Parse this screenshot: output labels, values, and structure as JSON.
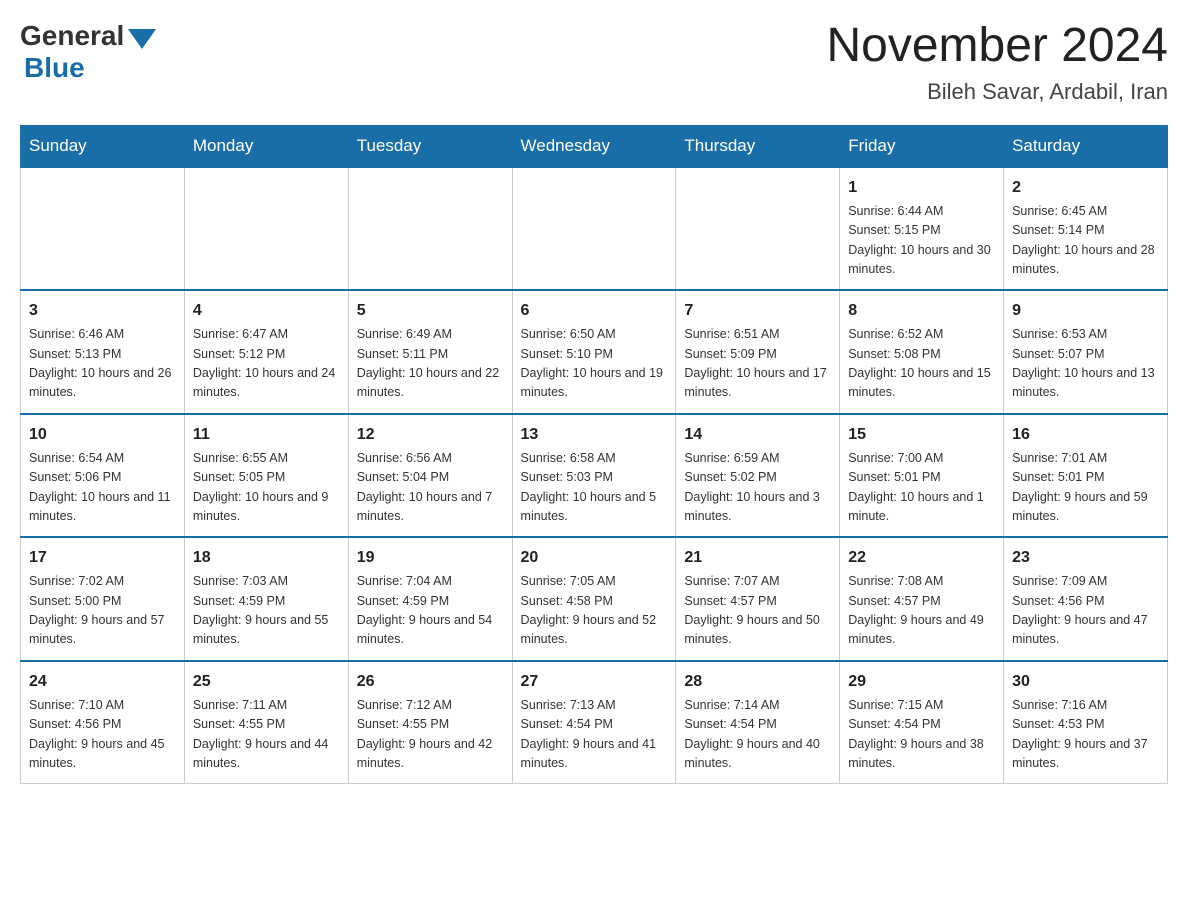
{
  "header": {
    "logo_general": "General",
    "logo_blue": "Blue",
    "month_title": "November 2024",
    "location": "Bileh Savar, Ardabil, Iran"
  },
  "weekdays": [
    "Sunday",
    "Monday",
    "Tuesday",
    "Wednesday",
    "Thursday",
    "Friday",
    "Saturday"
  ],
  "rows": [
    [
      {
        "day": "",
        "sunrise": "",
        "sunset": "",
        "daylight": ""
      },
      {
        "day": "",
        "sunrise": "",
        "sunset": "",
        "daylight": ""
      },
      {
        "day": "",
        "sunrise": "",
        "sunset": "",
        "daylight": ""
      },
      {
        "day": "",
        "sunrise": "",
        "sunset": "",
        "daylight": ""
      },
      {
        "day": "",
        "sunrise": "",
        "sunset": "",
        "daylight": ""
      },
      {
        "day": "1",
        "sunrise": "Sunrise: 6:44 AM",
        "sunset": "Sunset: 5:15 PM",
        "daylight": "Daylight: 10 hours and 30 minutes."
      },
      {
        "day": "2",
        "sunrise": "Sunrise: 6:45 AM",
        "sunset": "Sunset: 5:14 PM",
        "daylight": "Daylight: 10 hours and 28 minutes."
      }
    ],
    [
      {
        "day": "3",
        "sunrise": "Sunrise: 6:46 AM",
        "sunset": "Sunset: 5:13 PM",
        "daylight": "Daylight: 10 hours and 26 minutes."
      },
      {
        "day": "4",
        "sunrise": "Sunrise: 6:47 AM",
        "sunset": "Sunset: 5:12 PM",
        "daylight": "Daylight: 10 hours and 24 minutes."
      },
      {
        "day": "5",
        "sunrise": "Sunrise: 6:49 AM",
        "sunset": "Sunset: 5:11 PM",
        "daylight": "Daylight: 10 hours and 22 minutes."
      },
      {
        "day": "6",
        "sunrise": "Sunrise: 6:50 AM",
        "sunset": "Sunset: 5:10 PM",
        "daylight": "Daylight: 10 hours and 19 minutes."
      },
      {
        "day": "7",
        "sunrise": "Sunrise: 6:51 AM",
        "sunset": "Sunset: 5:09 PM",
        "daylight": "Daylight: 10 hours and 17 minutes."
      },
      {
        "day": "8",
        "sunrise": "Sunrise: 6:52 AM",
        "sunset": "Sunset: 5:08 PM",
        "daylight": "Daylight: 10 hours and 15 minutes."
      },
      {
        "day": "9",
        "sunrise": "Sunrise: 6:53 AM",
        "sunset": "Sunset: 5:07 PM",
        "daylight": "Daylight: 10 hours and 13 minutes."
      }
    ],
    [
      {
        "day": "10",
        "sunrise": "Sunrise: 6:54 AM",
        "sunset": "Sunset: 5:06 PM",
        "daylight": "Daylight: 10 hours and 11 minutes."
      },
      {
        "day": "11",
        "sunrise": "Sunrise: 6:55 AM",
        "sunset": "Sunset: 5:05 PM",
        "daylight": "Daylight: 10 hours and 9 minutes."
      },
      {
        "day": "12",
        "sunrise": "Sunrise: 6:56 AM",
        "sunset": "Sunset: 5:04 PM",
        "daylight": "Daylight: 10 hours and 7 minutes."
      },
      {
        "day": "13",
        "sunrise": "Sunrise: 6:58 AM",
        "sunset": "Sunset: 5:03 PM",
        "daylight": "Daylight: 10 hours and 5 minutes."
      },
      {
        "day": "14",
        "sunrise": "Sunrise: 6:59 AM",
        "sunset": "Sunset: 5:02 PM",
        "daylight": "Daylight: 10 hours and 3 minutes."
      },
      {
        "day": "15",
        "sunrise": "Sunrise: 7:00 AM",
        "sunset": "Sunset: 5:01 PM",
        "daylight": "Daylight: 10 hours and 1 minute."
      },
      {
        "day": "16",
        "sunrise": "Sunrise: 7:01 AM",
        "sunset": "Sunset: 5:01 PM",
        "daylight": "Daylight: 9 hours and 59 minutes."
      }
    ],
    [
      {
        "day": "17",
        "sunrise": "Sunrise: 7:02 AM",
        "sunset": "Sunset: 5:00 PM",
        "daylight": "Daylight: 9 hours and 57 minutes."
      },
      {
        "day": "18",
        "sunrise": "Sunrise: 7:03 AM",
        "sunset": "Sunset: 4:59 PM",
        "daylight": "Daylight: 9 hours and 55 minutes."
      },
      {
        "day": "19",
        "sunrise": "Sunrise: 7:04 AM",
        "sunset": "Sunset: 4:59 PM",
        "daylight": "Daylight: 9 hours and 54 minutes."
      },
      {
        "day": "20",
        "sunrise": "Sunrise: 7:05 AM",
        "sunset": "Sunset: 4:58 PM",
        "daylight": "Daylight: 9 hours and 52 minutes."
      },
      {
        "day": "21",
        "sunrise": "Sunrise: 7:07 AM",
        "sunset": "Sunset: 4:57 PM",
        "daylight": "Daylight: 9 hours and 50 minutes."
      },
      {
        "day": "22",
        "sunrise": "Sunrise: 7:08 AM",
        "sunset": "Sunset: 4:57 PM",
        "daylight": "Daylight: 9 hours and 49 minutes."
      },
      {
        "day": "23",
        "sunrise": "Sunrise: 7:09 AM",
        "sunset": "Sunset: 4:56 PM",
        "daylight": "Daylight: 9 hours and 47 minutes."
      }
    ],
    [
      {
        "day": "24",
        "sunrise": "Sunrise: 7:10 AM",
        "sunset": "Sunset: 4:56 PM",
        "daylight": "Daylight: 9 hours and 45 minutes."
      },
      {
        "day": "25",
        "sunrise": "Sunrise: 7:11 AM",
        "sunset": "Sunset: 4:55 PM",
        "daylight": "Daylight: 9 hours and 44 minutes."
      },
      {
        "day": "26",
        "sunrise": "Sunrise: 7:12 AM",
        "sunset": "Sunset: 4:55 PM",
        "daylight": "Daylight: 9 hours and 42 minutes."
      },
      {
        "day": "27",
        "sunrise": "Sunrise: 7:13 AM",
        "sunset": "Sunset: 4:54 PM",
        "daylight": "Daylight: 9 hours and 41 minutes."
      },
      {
        "day": "28",
        "sunrise": "Sunrise: 7:14 AM",
        "sunset": "Sunset: 4:54 PM",
        "daylight": "Daylight: 9 hours and 40 minutes."
      },
      {
        "day": "29",
        "sunrise": "Sunrise: 7:15 AM",
        "sunset": "Sunset: 4:54 PM",
        "daylight": "Daylight: 9 hours and 38 minutes."
      },
      {
        "day": "30",
        "sunrise": "Sunrise: 7:16 AM",
        "sunset": "Sunset: 4:53 PM",
        "daylight": "Daylight: 9 hours and 37 minutes."
      }
    ]
  ]
}
